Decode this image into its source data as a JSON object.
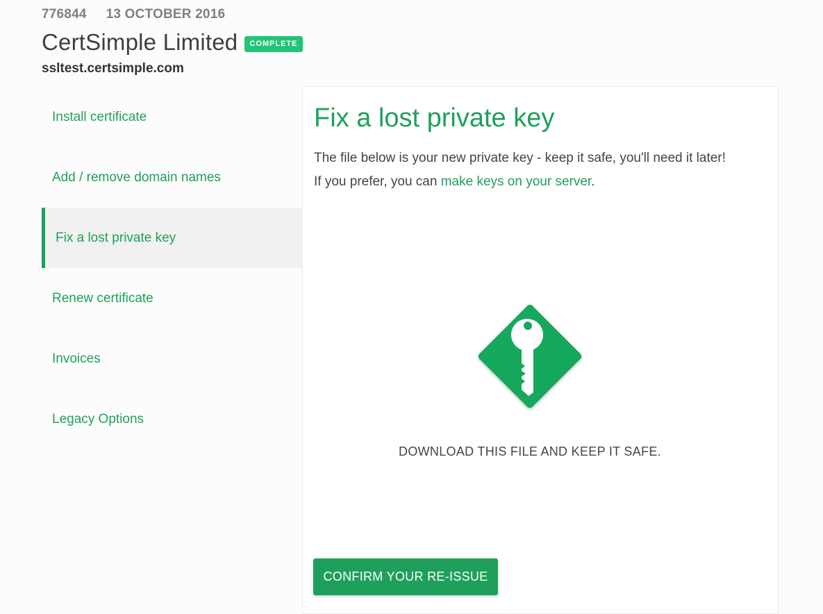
{
  "order": {
    "number": "776844",
    "date": "13 OCTOBER 2016",
    "company": "CertSimple Limited",
    "status_badge": "COMPLETE",
    "domain": "ssltest.certsimple.com"
  },
  "sidebar": {
    "items": [
      {
        "label": "Install certificate",
        "active": false
      },
      {
        "label": "Add / remove domain names",
        "active": false
      },
      {
        "label": "Fix a lost private key",
        "active": true
      },
      {
        "label": "Renew certificate",
        "active": false
      },
      {
        "label": "Invoices",
        "active": false
      },
      {
        "label": "Legacy Options",
        "active": false
      }
    ]
  },
  "main": {
    "title": "Fix a lost private key",
    "description_line1": "The file below is your new private key - keep it safe, you'll need it later!",
    "description_line2_prefix": "If you prefer, you can ",
    "description_link": "make keys on your server",
    "description_line2_suffix": ".",
    "key_icon": "key-icon",
    "download_text": "DOWNLOAD THIS FILE AND KEEP IT SAFE.",
    "confirm_button": "CONFIRM YOUR RE-ISSUE"
  },
  "colors": {
    "accent": "#1fa05a",
    "badge": "#22c477",
    "icon_green": "#17a85c"
  }
}
